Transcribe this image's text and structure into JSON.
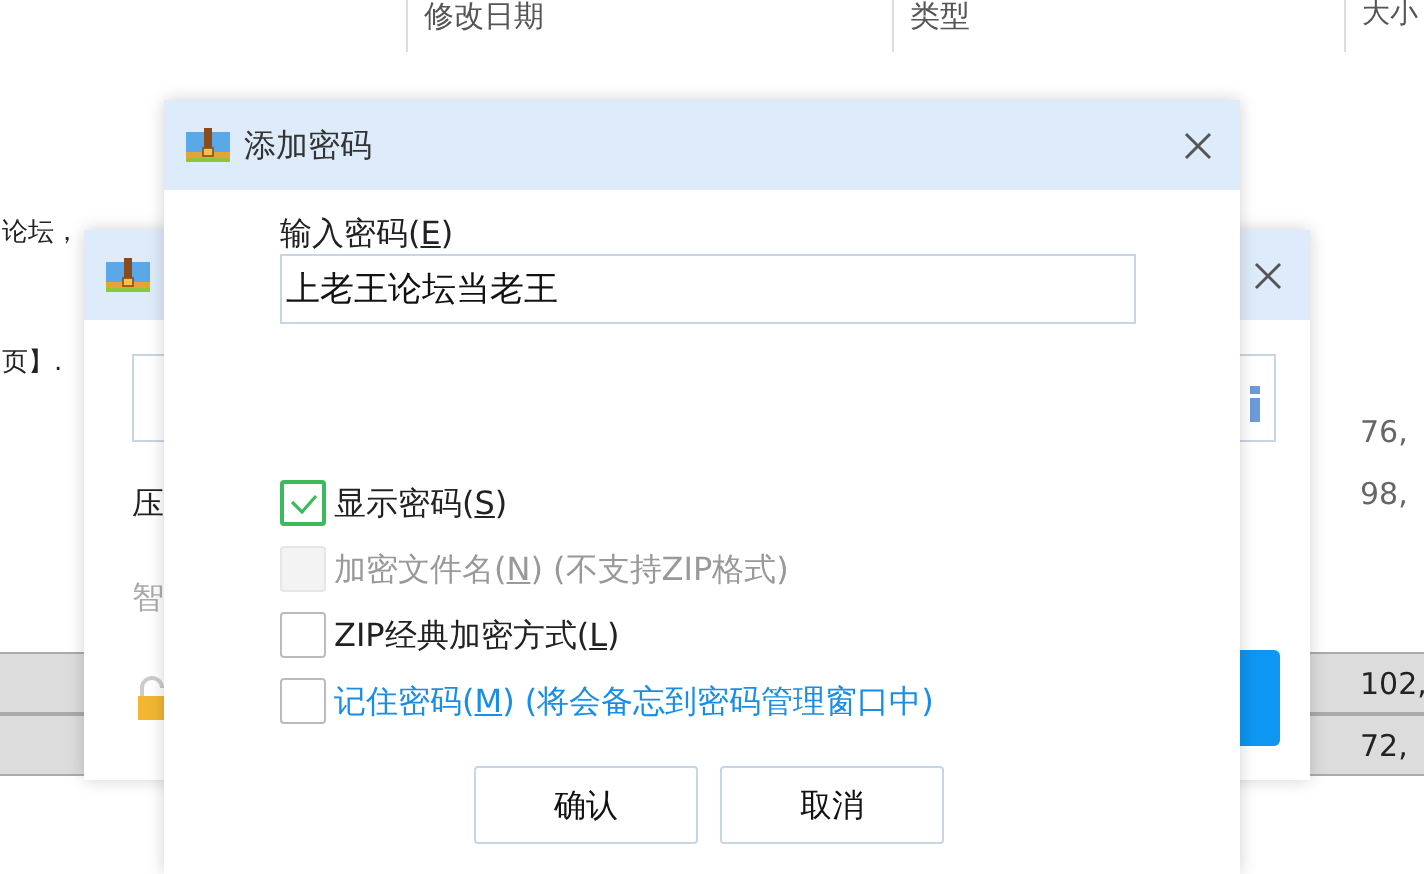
{
  "file_list": {
    "columns": [
      "修改日期",
      "类型",
      "大小"
    ],
    "left_texts": [
      "论坛，",
      "页】."
    ],
    "sizes": [
      {
        "text": "76,",
        "highlighted": false
      },
      {
        "text": "98,",
        "highlighted": false
      },
      {
        "text": "102,",
        "highlighted": true
      },
      {
        "text": "72,",
        "highlighted": true
      }
    ]
  },
  "back_dialog": {
    "labels": [
      {
        "text": "压",
        "muted": false
      },
      {
        "text": "智",
        "muted": true
      }
    ]
  },
  "dialog": {
    "title": "添加密码",
    "password_label": {
      "before": "输入密码(",
      "access_key": "E",
      "after": ")"
    },
    "password_value": "上老王论坛当老王",
    "options": [
      {
        "before": "显示密码(",
        "access_key": "S",
        "after": ")",
        "checked": true,
        "disabled": false,
        "link": false
      },
      {
        "before": "加密文件名(",
        "access_key": "N",
        "after": ") (不支持ZIP格式)",
        "checked": false,
        "disabled": true,
        "link": false
      },
      {
        "before": "ZIP经典加密方式(",
        "access_key": "L",
        "after": ")",
        "checked": false,
        "disabled": false,
        "link": false
      },
      {
        "before": "记住密码(",
        "access_key": "M",
        "after": ") (将会备忘到密码管理窗口中)",
        "checked": false,
        "disabled": false,
        "link": true
      }
    ],
    "buttons": [
      "确认",
      "取消"
    ]
  }
}
